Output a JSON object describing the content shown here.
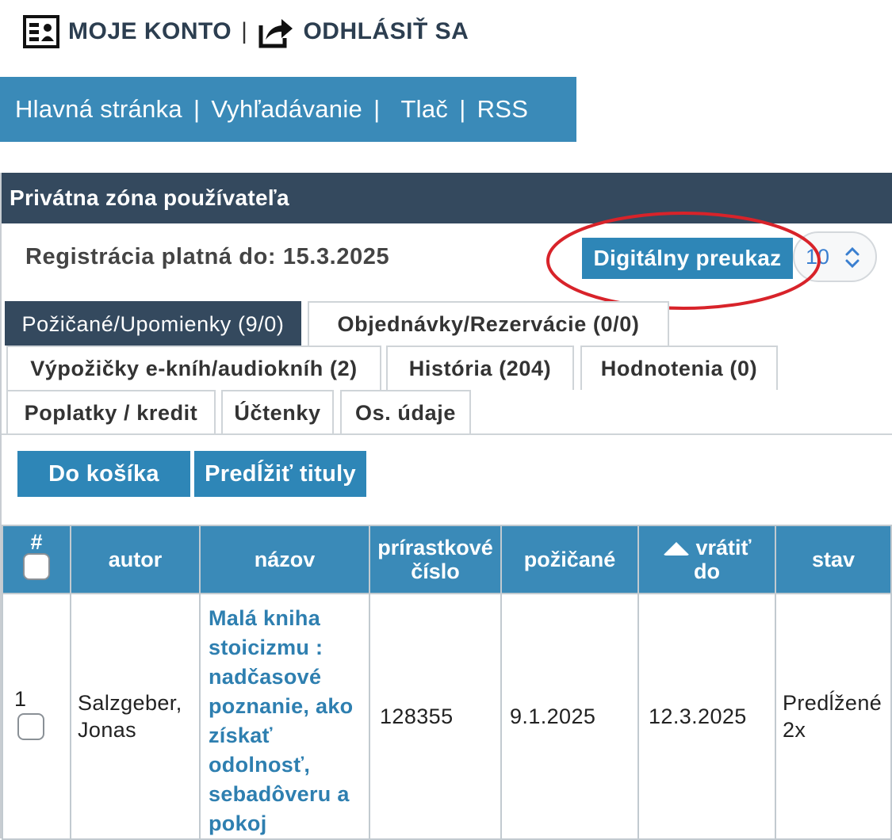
{
  "account": {
    "my_account": "MOJE KONTO",
    "separator": "|",
    "logout": "ODHLÁSIŤ SA"
  },
  "nav": {
    "home": "Hlavná stránka",
    "search": "Vyhľadávanie",
    "print": "Tlač",
    "rss": "RSS",
    "separator": "|"
  },
  "panel": {
    "title": "Privátna zóna používateľa",
    "registration_label": "Registrácia platná do:",
    "registration_date": "15.3.2025",
    "digital_card_button": "Digitálny preukaz",
    "page_size_value": "10"
  },
  "tabs": [
    {
      "label": "Požičané/Upomienky (9/0)",
      "active": true
    },
    {
      "label": "Objednávky/Rezervácie (0/0)",
      "active": false
    },
    {
      "label": "Výpožičky e-kníh/audiokníh (2)",
      "active": false
    },
    {
      "label": "História (204)",
      "active": false
    },
    {
      "label": "Hodnotenia (0)",
      "active": false
    },
    {
      "label": "Poplatky / kredit",
      "active": false
    },
    {
      "label": "Účtenky",
      "active": false
    },
    {
      "label": "Os. údaje",
      "active": false
    }
  ],
  "actions": {
    "add_to_cart": "Do košíka",
    "renew_titles": "Predĺžiť tituly"
  },
  "table": {
    "headers": {
      "number": "#",
      "author": "autor",
      "title": "názov",
      "accession_line1": "prírastkové",
      "accession_line2": "číslo",
      "borrowed": "požičané",
      "due_line1": "vrátiť",
      "due_line2": "do",
      "status": "stav"
    },
    "rows": [
      {
        "number": "1",
        "author_line1": "Salzgeber,",
        "author_line2": "Jonas",
        "title": "Malá kniha stoicizmu : nadčasové poznanie, ako získať odolnosť, sebadôveru a pokoj",
        "accession": "128355",
        "borrowed": "9.1.2025",
        "due": "12.3.2025",
        "status_line1": "Predĺžené",
        "status_line2": "2x"
      }
    ]
  },
  "colors": {
    "nav_blue": "#3a8ab8",
    "button_blue": "#2e86b7",
    "panel_dark": "#34495e",
    "link_blue": "#2e7fb0",
    "annotation_red": "#d8232a"
  }
}
